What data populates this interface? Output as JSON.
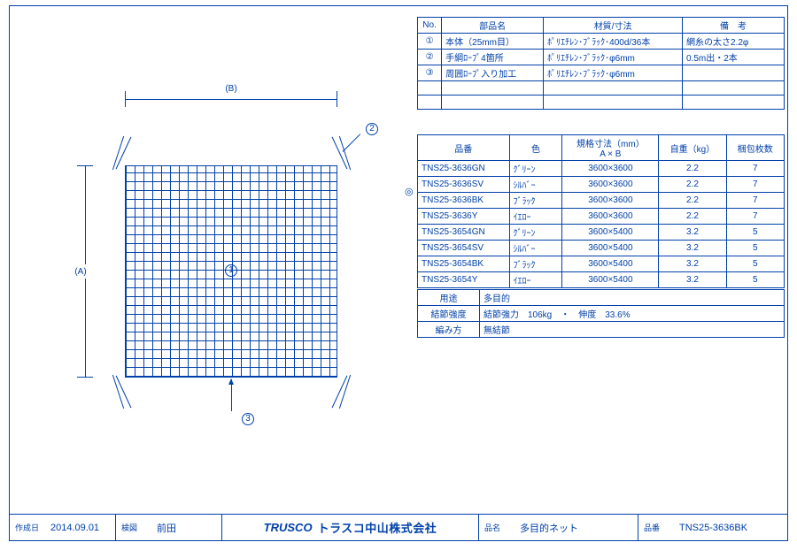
{
  "dimensions": {
    "a_label": "(A)",
    "b_label": "(B)"
  },
  "callouts": {
    "c1": "1",
    "c2": "2",
    "c3": "3"
  },
  "parts_table": {
    "headers": [
      "No.",
      "部品名",
      "材質/寸法",
      "備　考"
    ],
    "rows": [
      {
        "no": "①",
        "name": "本体（25mm目）",
        "spec": "ﾎﾟﾘｴﾁﾚﾝ･ﾌﾞﾗｯｸ･400d/36本",
        "note": "網糸の太さ2.2φ"
      },
      {
        "no": "②",
        "name": "手綱ﾛｰﾌﾟ4箇所",
        "spec": "ﾎﾟﾘｴﾁﾚﾝ･ﾌﾞﾗｯｸ･φ6mm",
        "note": "0.5m出・2本"
      },
      {
        "no": "③",
        "name": "周囲ﾛｰﾌﾟ入り加工",
        "spec": "ﾎﾟﾘｴﾁﾚﾝ･ﾌﾞﾗｯｸ･φ6mm",
        "note": ""
      }
    ]
  },
  "spec_table": {
    "headers": [
      "品番",
      "色",
      "規格寸法（mm）\nA × B",
      "自重（kg）",
      "梱包枚数"
    ],
    "rows": [
      {
        "pn": "TNS25-3636GN",
        "color": "ｸﾞﾘｰﾝ",
        "size": "3600×3600",
        "wt": "2.2",
        "qty": "7",
        "sel": false
      },
      {
        "pn": "TNS25-3636SV",
        "color": "ｼﾙﾊﾞｰ",
        "size": "3600×3600",
        "wt": "2.2",
        "qty": "7",
        "sel": false
      },
      {
        "pn": "TNS25-3636BK",
        "color": "ﾌﾞﾗｯｸ",
        "size": "3600×3600",
        "wt": "2.2",
        "qty": "7",
        "sel": true
      },
      {
        "pn": "TNS25-3636Y",
        "color": "ｲｴﾛｰ",
        "size": "3600×3600",
        "wt": "2.2",
        "qty": "7",
        "sel": false
      },
      {
        "pn": "TNS25-3654GN",
        "color": "ｸﾞﾘｰﾝ",
        "size": "3600×5400",
        "wt": "3.2",
        "qty": "5",
        "sel": false
      },
      {
        "pn": "TNS25-3654SV",
        "color": "ｼﾙﾊﾞｰ",
        "size": "3600×5400",
        "wt": "3.2",
        "qty": "5",
        "sel": false
      },
      {
        "pn": "TNS25-3654BK",
        "color": "ﾌﾞﾗｯｸ",
        "size": "3600×5400",
        "wt": "3.2",
        "qty": "5",
        "sel": false
      },
      {
        "pn": "TNS25-3654Y",
        "color": "ｲｴﾛｰ",
        "size": "3600×5400",
        "wt": "3.2",
        "qty": "5",
        "sel": false
      }
    ],
    "sel_mark": "◎"
  },
  "info_table": {
    "rows": [
      {
        "k": "用途",
        "v": "多目的"
      },
      {
        "k": "結節強度",
        "v": "結節強力　106kg　・　伸度　33.6%"
      },
      {
        "k": "編み方",
        "v": "無結節"
      }
    ]
  },
  "titleblock": {
    "date_label": "作成日",
    "date": "2014.09.01",
    "check_label": "検図",
    "check": "前田",
    "brand": "TRUSCO",
    "company": "トラスコ中山株式会社",
    "name_label": "品名",
    "name": "多目的ネット",
    "pn_label": "品番",
    "pn": "TNS25-3636BK"
  }
}
